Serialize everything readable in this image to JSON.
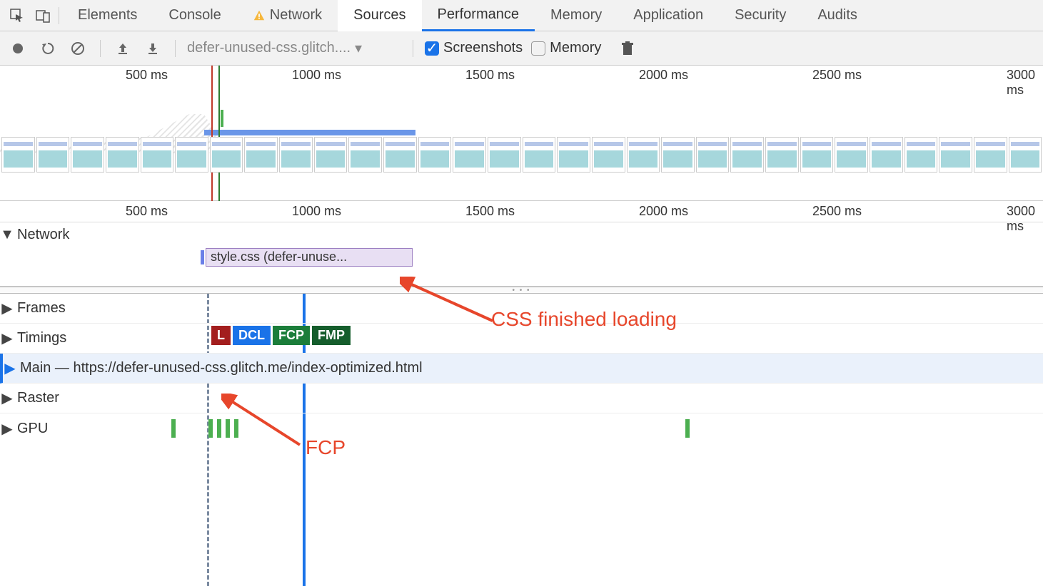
{
  "tabs": {
    "items": [
      "Elements",
      "Console",
      "Network",
      "Sources",
      "Performance",
      "Memory",
      "Application",
      "Security",
      "Audits"
    ],
    "active_index": 3,
    "highlight_index": 4,
    "warning_index": 2
  },
  "toolbar": {
    "dropdown_label": "defer-unused-css.glitch....",
    "screenshots_label": "Screenshots",
    "screenshots_checked": true,
    "memory_label": "Memory",
    "memory_checked": false
  },
  "overview_ruler": {
    "ticks": [
      {
        "label": "500 ms",
        "pos": 243
      },
      {
        "label": "1000 ms",
        "pos": 486
      },
      {
        "label": "1500 ms",
        "pos": 729
      },
      {
        "label": "2000 ms",
        "pos": 972
      },
      {
        "label": "2500 ms",
        "pos": 1215
      },
      {
        "label": "3000 ms",
        "pos": 1458
      }
    ]
  },
  "detail_ruler": {
    "ticks": [
      {
        "label": "500 ms",
        "pos": 243
      },
      {
        "label": "1000 ms",
        "pos": 486
      },
      {
        "label": "1500 ms",
        "pos": 729
      },
      {
        "label": "2000 ms",
        "pos": 972
      },
      {
        "label": "2500 ms",
        "pos": 1215
      },
      {
        "label": "3000 ms",
        "pos": 1458
      }
    ]
  },
  "tracks": {
    "network_label": "Network",
    "network_item": "style.css (defer-unuse...",
    "frames_label": "Frames",
    "timings_label": "Timings",
    "timings_badges": {
      "l": "L",
      "dcl": "DCL",
      "fcp": "FCP",
      "fmp": "FMP"
    },
    "main_label": "Main — https://defer-unused-css.glitch.me/index-optimized.html",
    "raster_label": "Raster",
    "gpu_label": "GPU"
  },
  "annotations": {
    "css_loaded": "CSS finished loading",
    "fcp": "FCP"
  }
}
